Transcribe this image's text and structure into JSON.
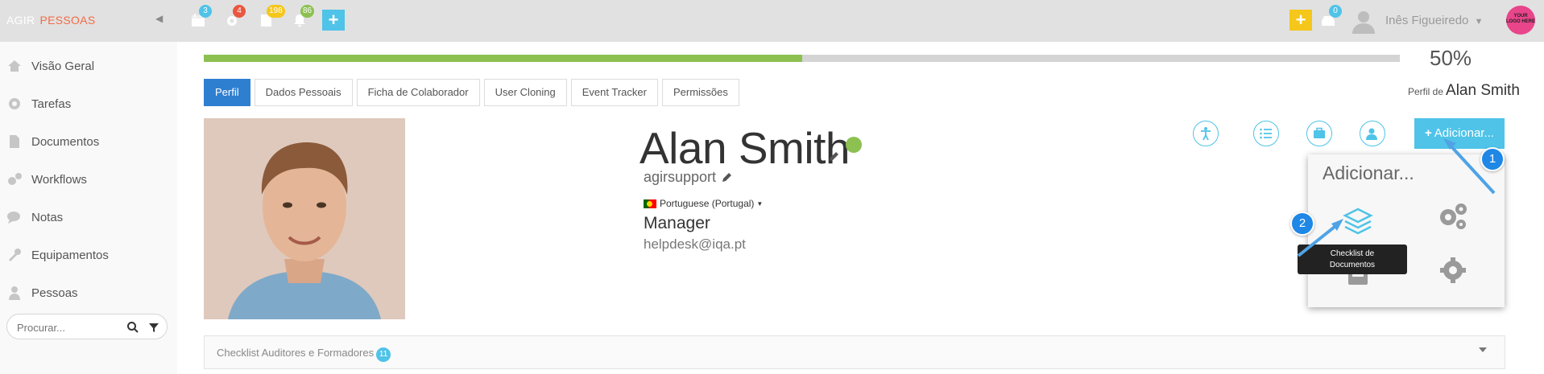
{
  "brand": {
    "part1": "AGIR",
    "part2": "PESSOAS"
  },
  "topbar": {
    "calendar_count": "3",
    "settings_count": "4",
    "documents_count": "198",
    "notifications_count": "86",
    "messages_count": "0",
    "user_name": "Inês Figueiredo",
    "logo_text": "YOUR LOGO HERE"
  },
  "sidebar": {
    "items": [
      {
        "label": "Visão Geral",
        "icon": "home-icon"
      },
      {
        "label": "Tarefas",
        "icon": "gear-icon"
      },
      {
        "label": "Documentos",
        "icon": "document-icon"
      },
      {
        "label": "Workflows",
        "icon": "gears-icon"
      },
      {
        "label": "Notas",
        "icon": "comments-icon"
      },
      {
        "label": "Equipamentos",
        "icon": "wrench-icon"
      },
      {
        "label": "Pessoas",
        "icon": "user-icon"
      }
    ],
    "search_placeholder": "Procurar..."
  },
  "progress": {
    "percent": 50,
    "label": "50%"
  },
  "profile_of": {
    "prefix": "Perfil de",
    "name": "Alan Smith"
  },
  "tabs": [
    "Perfil",
    "Dados Pessoais",
    "Ficha de Colaborador",
    "User Cloning",
    "Event Tracker",
    "Permissões"
  ],
  "profile": {
    "name": "Alan Smith",
    "username": "agirsupport",
    "language": "Portuguese (Portugal)",
    "role": "Manager",
    "email": "helpdesk@iqa.pt"
  },
  "add_button": "Adicionar...",
  "dropdown": {
    "title": "Adicionar...",
    "tooltip_line1": "Checklist de",
    "tooltip_line2": "Documentos"
  },
  "steps": [
    "1",
    "2"
  ],
  "accordion": {
    "label": "Checklist Auditores e Formadores",
    "count": "11"
  },
  "colors": {
    "accent": "#4fc3e8",
    "primary": "#2f7fd1",
    "success": "#8cc152",
    "brand_orange": "#f36b47"
  }
}
